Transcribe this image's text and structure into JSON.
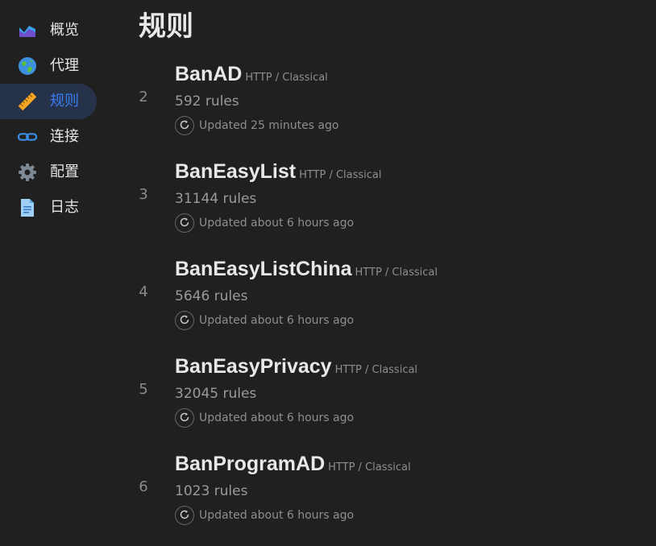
{
  "sidebar": {
    "items": [
      {
        "label": "概览",
        "icon": "area-chart-icon",
        "active": false
      },
      {
        "label": "代理",
        "icon": "globe-icon",
        "active": false
      },
      {
        "label": "规则",
        "icon": "ruler-icon",
        "active": true
      },
      {
        "label": "连接",
        "icon": "link-icon",
        "active": false
      },
      {
        "label": "配置",
        "icon": "gear-icon",
        "active": false
      },
      {
        "label": "日志",
        "icon": "document-icon",
        "active": false
      }
    ]
  },
  "page": {
    "title": "规则"
  },
  "rules": [
    {
      "index": "2",
      "name": "BanAD",
      "type": "HTTP / Classical",
      "count": "592 rules",
      "updated": "Updated 25 minutes ago"
    },
    {
      "index": "3",
      "name": "BanEasyList",
      "type": "HTTP / Classical",
      "count": "31144 rules",
      "updated": "Updated about 6 hours ago"
    },
    {
      "index": "4",
      "name": "BanEasyListChina",
      "type": "HTTP / Classical",
      "count": "5646 rules",
      "updated": "Updated about 6 hours ago"
    },
    {
      "index": "5",
      "name": "BanEasyPrivacy",
      "type": "HTTP / Classical",
      "count": "32045 rules",
      "updated": "Updated about 6 hours ago"
    },
    {
      "index": "6",
      "name": "BanProgramAD",
      "type": "HTTP / Classical",
      "count": "1023 rules",
      "updated": "Updated about 6 hours ago"
    }
  ],
  "colors": {
    "background": "#202020",
    "active_bg": "#25324a",
    "active_text": "#3a7df0",
    "muted": "#8e8e8e"
  }
}
